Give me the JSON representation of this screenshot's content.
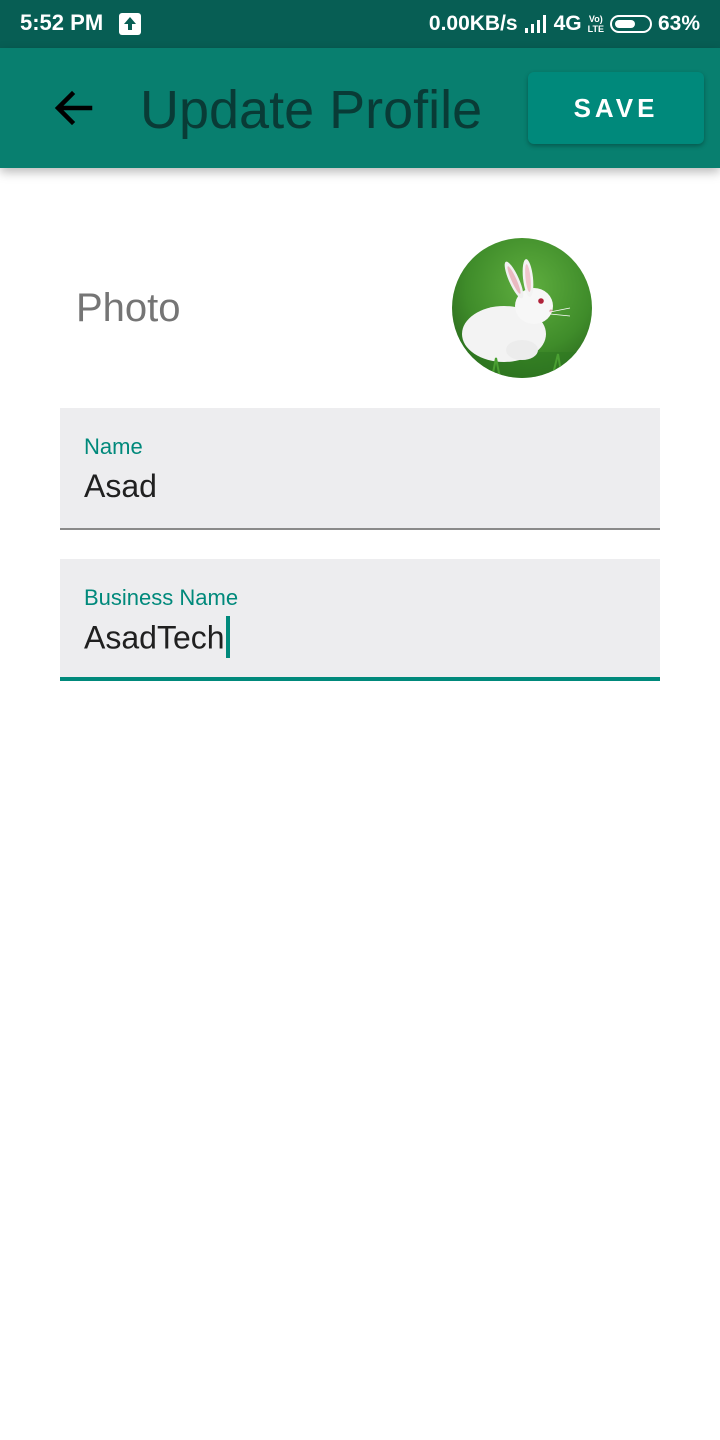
{
  "status_bar": {
    "time": "5:52 PM",
    "upload_icon": "upload-arrow-icon",
    "net_speed": "0.00KB/s",
    "signal_icon": "signal-bars-icon",
    "network": "4G",
    "volte_top": "Vo)",
    "volte_bottom": "LTE",
    "battery_icon": "battery-icon",
    "battery_level": 0.63,
    "battery": "63%"
  },
  "app_bar": {
    "back_icon": "arrow-back-icon",
    "title": "Update Profile",
    "save_label": "SAVE",
    "color": "#087f6f"
  },
  "profile": {
    "photo_label": "Photo",
    "avatar_icon": "rabbit-photo"
  },
  "form": {
    "name_label": "Name",
    "name_value": "Asad",
    "business_label": "Business Name",
    "business_value": "AsadTech"
  },
  "colors": {
    "accent": "#00897b",
    "status_bar": "#075e54"
  }
}
